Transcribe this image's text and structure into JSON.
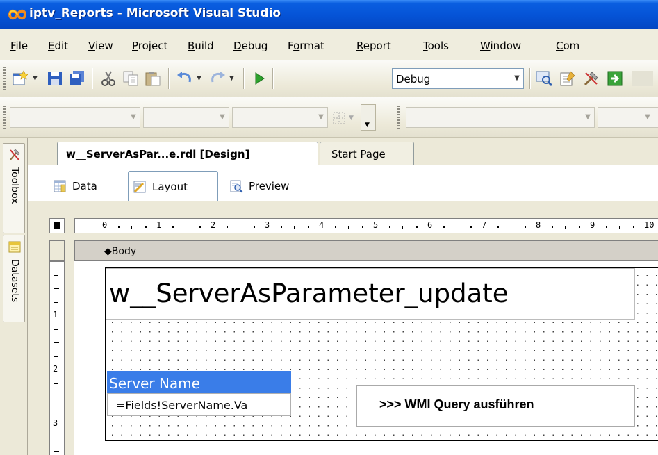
{
  "window": {
    "title": "iptv_Reports - Microsoft Visual Studio"
  },
  "menu": {
    "items": [
      {
        "accel": "F",
        "rest": "ile"
      },
      {
        "accel": "E",
        "rest": "dit"
      },
      {
        "accel": "V",
        "rest": "iew"
      },
      {
        "accel": "P",
        "rest": "roject"
      },
      {
        "accel": "B",
        "rest": "uild"
      },
      {
        "accel": "D",
        "rest": "ebug"
      },
      {
        "pre": "F",
        "accel": "o",
        "rest": "rmat"
      },
      {
        "accel": "R",
        "rest": "eport"
      },
      {
        "accel": "T",
        "rest": "ools"
      },
      {
        "accel": "W",
        "rest": "indow"
      },
      {
        "accel": "C",
        "rest": "om"
      }
    ]
  },
  "toolbar": {
    "config_combo_value": "Debug",
    "icons": [
      "new-project-icon",
      "save-icon",
      "save-all-icon",
      "cut-icon",
      "copy-icon",
      "paste-icon",
      "undo-icon",
      "redo-icon",
      "start-debug-icon",
      "find-in-files-icon",
      "properties-icon",
      "toolbox-icon",
      "object-browser-icon"
    ]
  },
  "side_panel": {
    "toolbox_label": "Toolbox",
    "datasets_label": "Datasets"
  },
  "doc_tabs": [
    {
      "label": "w__ServerAsPar...e.rdl [Design]",
      "active": true
    },
    {
      "label": "Start Page",
      "active": false
    }
  ],
  "designer_tabs": [
    {
      "label": "Data",
      "active": false
    },
    {
      "label": "Layout",
      "active": true
    },
    {
      "label": "Preview",
      "active": false
    }
  ],
  "ruler": {
    "h_numbers": [
      "0",
      "1",
      "2",
      "3",
      "4",
      "5",
      "6",
      "7",
      "8",
      "9",
      "10"
    ],
    "v_numbers": [
      "1",
      "2",
      "3"
    ]
  },
  "design_surface": {
    "section_label": "Body",
    "report_title": "w__ServerAsParameter_update",
    "column_header": "Server Name",
    "field_expression": "=Fields!ServerName.Va",
    "button_text": ">>> WMI Query ausführen"
  },
  "colors": {
    "titlebar": "#0553d6",
    "column_header_bg": "#3a7de8"
  }
}
